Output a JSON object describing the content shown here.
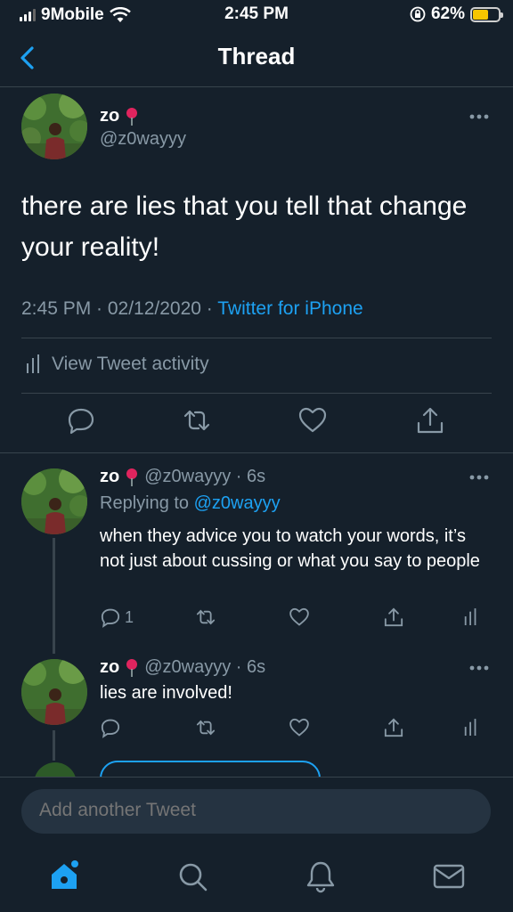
{
  "status_bar": {
    "carrier": "9Mobile",
    "time": "2:45 PM",
    "battery": "62%"
  },
  "header": {
    "title": "Thread"
  },
  "main_tweet": {
    "name": "zo",
    "handle": "@z0wayyy",
    "text": "there are lies that you tell that change your reality!",
    "time_date": "2:45 PM · 02/12/2020 · ",
    "source": "Twitter for iPhone",
    "activity_label": "View Tweet activity"
  },
  "replies": [
    {
      "name": "zo",
      "handle": "@z0wayyy · 6s",
      "replying_prefix": "Replying to ",
      "replying_to": "@z0wayyy",
      "text": "when they advice you to watch your words, it’s not just about cussing or what you say to people",
      "reply_count": "1"
    },
    {
      "name": "zo",
      "handle": "@z0wayyy · 6s",
      "text": "lies are involved!"
    }
  ],
  "compose": {
    "placeholder": "Add another Tweet"
  },
  "colors": {
    "background": "#15202b",
    "accent": "#1da1f2",
    "muted": "#8899a6",
    "divider": "#38444d"
  },
  "icons": [
    "back-chevron-icon",
    "more-icon",
    "reply-icon",
    "retweet-icon",
    "like-icon",
    "share-icon",
    "activity-icon",
    "pin-emoji-icon",
    "home-icon",
    "search-icon",
    "notifications-icon",
    "messages-icon"
  ]
}
